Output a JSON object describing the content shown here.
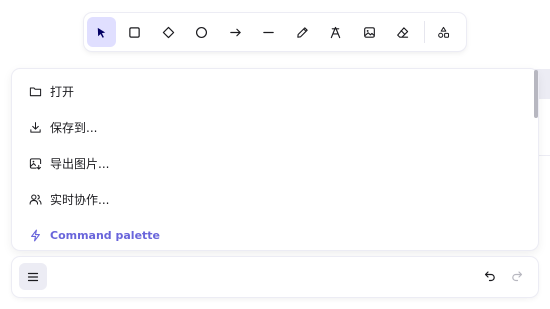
{
  "toolbar": {
    "tools": [
      {
        "name": "selection-tool",
        "icon": "cursor-icon",
        "active": true
      },
      {
        "name": "rectangle-tool",
        "icon": "square-icon",
        "active": false
      },
      {
        "name": "diamond-tool",
        "icon": "diamond-icon",
        "active": false
      },
      {
        "name": "ellipse-tool",
        "icon": "circle-icon",
        "active": false
      },
      {
        "name": "arrow-tool",
        "icon": "arrow-right-icon",
        "active": false
      },
      {
        "name": "line-tool",
        "icon": "line-icon",
        "active": false
      },
      {
        "name": "draw-tool",
        "icon": "pencil-icon",
        "active": false
      },
      {
        "name": "text-tool",
        "icon": "text-icon",
        "active": false
      },
      {
        "name": "image-tool",
        "icon": "image-icon",
        "active": false
      },
      {
        "name": "eraser-tool",
        "icon": "eraser-icon",
        "active": false
      },
      {
        "name": "more-shapes-tool",
        "icon": "shapes-icon",
        "active": false
      }
    ],
    "active_color": "#e0dfff"
  },
  "menu": {
    "items": [
      {
        "label": "打开",
        "icon": "folder-icon"
      },
      {
        "label": "保存到...",
        "icon": "download-icon"
      },
      {
        "label": "导出图片...",
        "icon": "export-image-icon"
      },
      {
        "label": "实时协作...",
        "icon": "users-icon"
      },
      {
        "label": "Command palette",
        "icon": "bolt-icon"
      }
    ],
    "accent_color": "#6965db"
  },
  "footer": {
    "menu_icon": "hamburger-icon",
    "undo_icon": "undo-icon",
    "redo_icon": "redo-icon"
  }
}
